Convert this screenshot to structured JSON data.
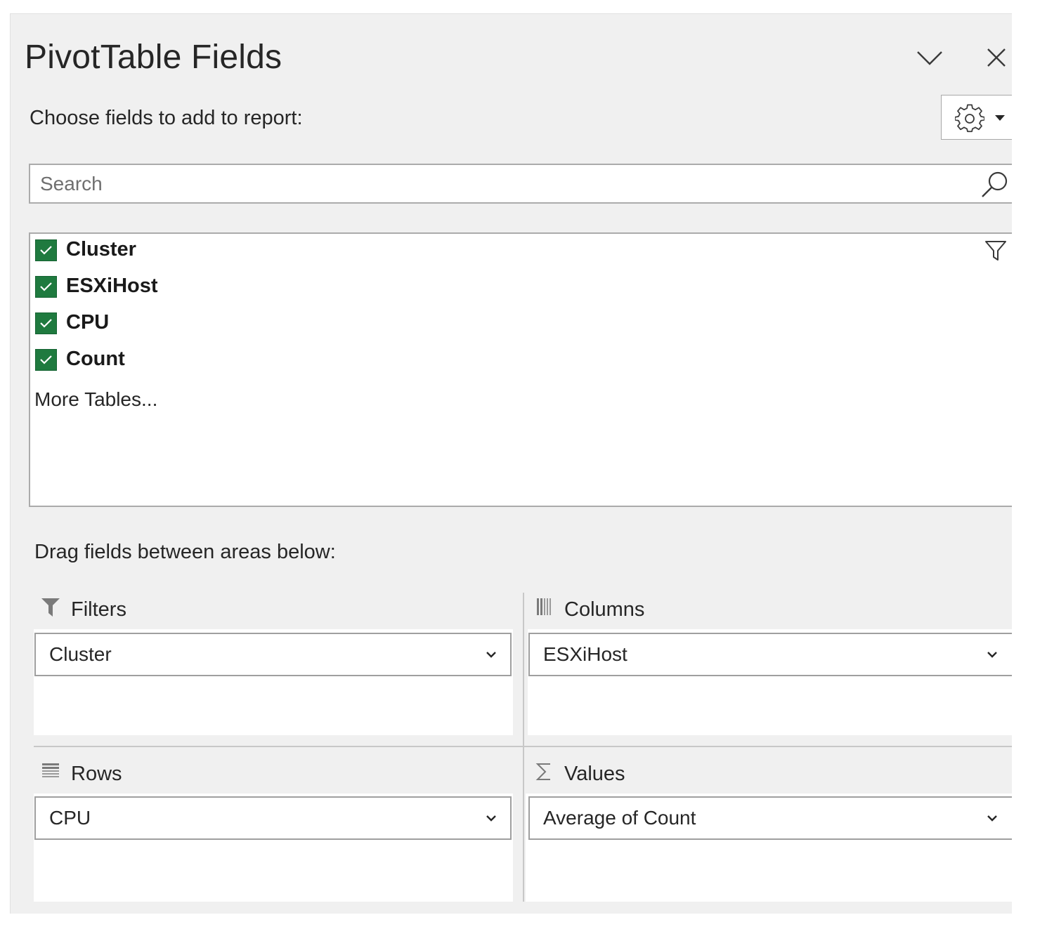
{
  "pane": {
    "title": "PivotTable Fields",
    "collapse_icon": "chevron-down-icon",
    "close_icon": "close-icon",
    "subtitle": "Choose fields to add to report:",
    "tools_icon": "gear-icon"
  },
  "search": {
    "placeholder": "Search",
    "value": "",
    "icon": "search-icon"
  },
  "field_list": {
    "fields": [
      {
        "label": "Cluster",
        "checked": true
      },
      {
        "label": "ESXiHost",
        "checked": true
      },
      {
        "label": "CPU",
        "checked": true
      },
      {
        "label": "Count",
        "checked": true
      }
    ],
    "more_tables": "More Tables...",
    "filter_icon": "filter-icon"
  },
  "areas": {
    "drag_label": "Drag fields between areas below:",
    "filters": {
      "title": "Filters",
      "icon": "filter-icon",
      "items": [
        "Cluster"
      ]
    },
    "columns": {
      "title": "Columns",
      "icon": "columns-icon",
      "items": [
        "ESXiHost"
      ]
    },
    "rows": {
      "title": "Rows",
      "icon": "rows-icon",
      "items": [
        "CPU"
      ]
    },
    "values": {
      "title": "Values",
      "icon": "sigma-icon",
      "items": [
        "Average of Count"
      ]
    }
  },
  "colors": {
    "pane_bg": "#f0f0f0",
    "checkbox_green": "#1f7a3f",
    "border": "#ababab"
  }
}
